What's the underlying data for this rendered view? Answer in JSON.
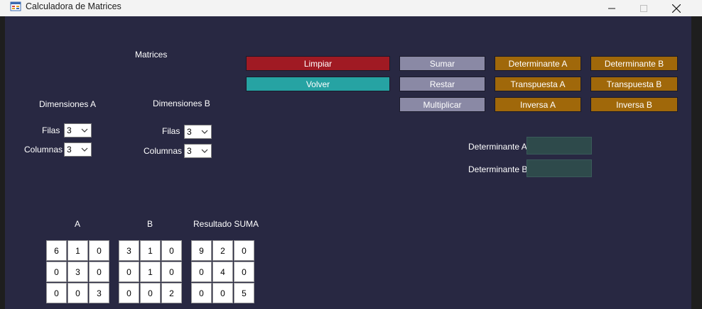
{
  "window": {
    "title": "Calculadora de Matrices"
  },
  "labels": {
    "matrices": "Matrices",
    "dimensions_a": "Dimensiones A",
    "dimensions_b": "Dimensiones B",
    "filas_a": "Filas",
    "columnas_a": "Columnas",
    "filas_b": "Filas",
    "columnas_b": "Columnas",
    "determinante_a": "Determinante A",
    "determinante_b": "Determinante B",
    "grid_a_title": "A",
    "grid_b_title": "B",
    "grid_result_title": "Resultado SUMA"
  },
  "combos": {
    "filas_a": "3",
    "columnas_a": "3",
    "filas_b": "3",
    "columnas_b": "3"
  },
  "buttons": {
    "limpiar": "Limpiar",
    "volver": "Volver",
    "sumar": "Sumar",
    "restar": "Restar",
    "multiplicar": "Multiplicar",
    "det_a": "Determinante A",
    "det_b": "Determinante B",
    "transp_a": "Transpuesta A",
    "transp_b": "Transpuesta B",
    "inversa_a": "Inversa A",
    "inversa_b": "Inversa B"
  },
  "colors": {
    "limpiar": "#a01a23",
    "volver": "#26a3a3",
    "ops": "#8a89a5",
    "matrix_ops": "#a0680a",
    "client_bg": "#282842",
    "det_field": "#2e4a4b"
  },
  "matrices": {
    "a": [
      [
        "6",
        "1",
        "0"
      ],
      [
        "0",
        "3",
        "0"
      ],
      [
        "0",
        "0",
        "3"
      ]
    ],
    "b": [
      [
        "3",
        "1",
        "0"
      ],
      [
        "0",
        "1",
        "0"
      ],
      [
        "0",
        "0",
        "2"
      ]
    ],
    "result": [
      [
        "9",
        "2",
        "0"
      ],
      [
        "0",
        "4",
        "0"
      ],
      [
        "0",
        "0",
        "5"
      ]
    ]
  }
}
